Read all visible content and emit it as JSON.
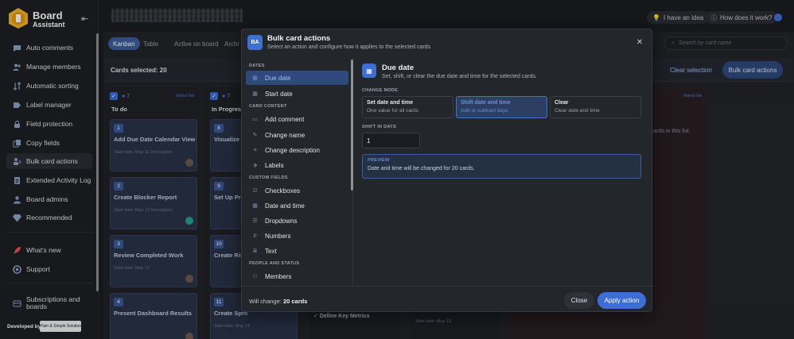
{
  "app": {
    "name_line1": "Board",
    "name_line2": "Assistant"
  },
  "sidebar": {
    "items": [
      {
        "label": "Auto comments",
        "icon": "chat-icon"
      },
      {
        "label": "Manage members",
        "icon": "users-icon"
      },
      {
        "label": "Automatic sorting",
        "icon": "sort-icon"
      },
      {
        "label": "Label manager",
        "icon": "label-icon"
      },
      {
        "label": "Field protection",
        "icon": "lock-icon"
      },
      {
        "label": "Copy fields",
        "icon": "copy-icon"
      },
      {
        "label": "Bulk card actions",
        "icon": "bulk-icon"
      },
      {
        "label": "Extended Activity Log",
        "icon": "log-icon"
      },
      {
        "label": "Board admins",
        "icon": "admin-icon"
      },
      {
        "label": "Recommended",
        "icon": "diamond-icon"
      }
    ],
    "whats_new": "What's new",
    "support": "Support",
    "subscriptions": "Subscriptions and boards",
    "developed_by": "Developed by",
    "partner": "Plain & Simple Solution"
  },
  "topbar": {
    "idea": "I have an idea",
    "how": "How does it work?"
  },
  "board": {
    "tabs": [
      "Kanban",
      "Table",
      "Active on board",
      "Archi"
    ],
    "search_placeholder": "Search by card name",
    "cards_selected": "Cards selected: 20",
    "clear_selection": "Clear selection",
    "bulk_actions": "Bulk card actions",
    "columns": [
      {
        "count": "7",
        "title": "To do",
        "select": "Select list",
        "cards": [
          {
            "num": "1",
            "title": "Add Due Date Calendar View",
            "meta": "Start date: May 11   Description"
          },
          {
            "num": "2",
            "title": "Create Blocker Report",
            "meta": "Start date: May 12   Description"
          },
          {
            "num": "3",
            "title": "Review Completed Work",
            "meta": "Start date: May 12"
          },
          {
            "num": "4",
            "title": "Present Dashboard Results",
            "meta": ""
          }
        ]
      },
      {
        "count": "7",
        "title": "In Progress",
        "select": "",
        "cards": [
          {
            "num": "8",
            "title": "Visualize T",
            "meta": ""
          },
          {
            "num": "9",
            "title": "Set Up Prio",
            "meta": ""
          },
          {
            "num": "10",
            "title": "Create Risk",
            "meta": ""
          },
          {
            "num": "11",
            "title": "Create Sprii",
            "meta": "Start date: May 14"
          }
        ]
      }
    ],
    "other_col_text": "cards in this list.",
    "select_set": "Select list",
    "bottom_card": "Define Key Metrics",
    "bottom_meta": "Start date: May 12"
  },
  "modal": {
    "logo": "BA",
    "title": "Bulk card actions",
    "subtitle": "Select an action and configure how it applies to the selected cards",
    "groups": {
      "dates": "DATES",
      "card_content": "CARD CONTENT",
      "custom_fields": "CUSTOM FIELDS",
      "people": "PEOPLE AND STATUS"
    },
    "options": {
      "due_date": "Due date",
      "start_date": "Start date",
      "add_comment": "Add comment",
      "change_name": "Change name",
      "change_description": "Change description",
      "labels": "Labels",
      "checkboxes": "Checkboxes",
      "date_time": "Date and time",
      "dropdowns": "Dropdowns",
      "numbers": "Numbers",
      "text": "Text",
      "members": "Members"
    },
    "detail": {
      "title": "Due date",
      "subtitle": "Set, shift, or clear the due date and time for the selected cards.",
      "change_mode_label": "CHANGE MODE",
      "modes": [
        {
          "title": "Set date and time",
          "desc": "One value for all cards"
        },
        {
          "title": "Shift date and time",
          "desc": "Add or subtract days"
        },
        {
          "title": "Clear",
          "desc": "Clear date and time"
        }
      ],
      "shift_label": "SHIFT IN DAYS",
      "shift_value": "1",
      "preview_label": "PREVIEW",
      "preview_text": "Date and time will be changed for 20 cards."
    },
    "footer": {
      "will_change": "Will change:",
      "count": "20 cards",
      "close": "Close",
      "apply": "Apply action"
    }
  },
  "colors": {
    "accent": "#3d6ed6",
    "bg": "#1b1d21",
    "modal": "#23262b"
  }
}
